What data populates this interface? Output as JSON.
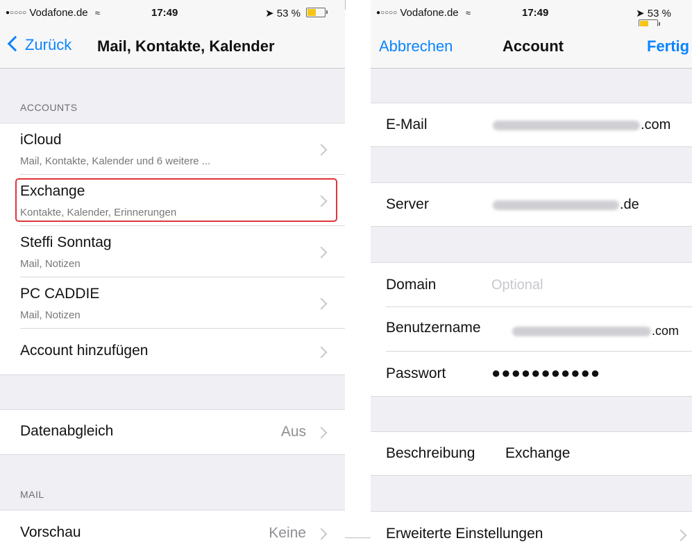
{
  "left": {
    "status": {
      "carrier": "Vodafone.de",
      "signal": "●○○○○",
      "time": "17:49",
      "battery": "53 %",
      "battery_level": 0.53
    },
    "nav": {
      "back_label": "Zurück",
      "title": "Mail, Kontakte, Kalender"
    },
    "accounts_header": "ACCOUNTS",
    "accounts": [
      {
        "title": "iCloud",
        "subtitle": "Mail, Kontakte, Kalender und 6 weitere ..."
      },
      {
        "title": "Exchange",
        "subtitle": "Kontakte, Kalender, Erinnerungen"
      },
      {
        "title": "Steffi Sonntag",
        "subtitle": "Mail, Notizen"
      },
      {
        "title": "PC CADDIE",
        "subtitle": "Mail, Notizen"
      },
      {
        "title": "Account hinzufügen"
      }
    ],
    "fetch": {
      "title": "Datenabgleich",
      "value": "Aus"
    },
    "mail_header": "MAIL",
    "preview": {
      "title": "Vorschau",
      "value": "Keine"
    }
  },
  "right": {
    "status": {
      "carrier": "Vodafone.de",
      "signal": "●○○○○",
      "time": "17:49",
      "battery": "53 %"
    },
    "nav": {
      "cancel": "Abbrechen",
      "title": "Account",
      "done": "Fertig"
    },
    "email": {
      "label": "E-Mail",
      "suffix": ".com"
    },
    "server": {
      "label": "Server",
      "suffix": ".de"
    },
    "domain": {
      "label": "Domain",
      "placeholder": "Optional"
    },
    "username": {
      "label": "Benutzername",
      "suffix": ".com"
    },
    "password": {
      "label": "Passwort",
      "masked": "●●●●●●●●●●●"
    },
    "description": {
      "label": "Beschreibung",
      "value": "Exchange"
    },
    "advanced": {
      "label": "Erweiterte Einstellungen"
    }
  }
}
